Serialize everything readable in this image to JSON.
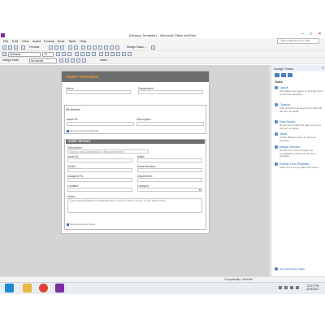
{
  "window": {
    "title": "(Design) Template1 - Microsoft Office InfoPath",
    "min": "–",
    "max": "□",
    "close": "✕"
  },
  "menu": {
    "items": [
      "File",
      "Edit",
      "View",
      "Insert",
      "Format",
      "Tools",
      "Table",
      "Help"
    ],
    "help_placeholder": "Type a question for help"
  },
  "toolbar": {
    "preview_label": "Preview",
    "design_tasks_label": "Design Tasks...",
    "font_name": "Verdana",
    "font_size": "10",
    "design_table_label": "Design Table",
    "border_label": "No border",
    "insert_label": "Insert"
  },
  "form": {
    "title": "ASSET TRACKING",
    "name_label": "Name:",
    "department_label": "Department:",
    "all_assets_title": "All Assets",
    "asset_id_label": "Asset ID:",
    "description_label": "Description:",
    "remove_asset_1": "Removing Asset (Variable)",
    "asset_details_title": "ASSET DETAILS",
    "details_description_label": "Description:",
    "details_description_hint": "[Type a short description of this asset here]",
    "details_asset_id_label": "Asset ID:",
    "make_label": "Make:",
    "model_label": "Model:",
    "serial_label": "Serial Number:",
    "assigned_label": "Assigned To:",
    "details_department_label": "Department:",
    "location_label": "Location:",
    "category_label": "Category:",
    "notes_label": "Notes:",
    "notes_hint": "[Type any additional comments about and/or insert a photo of the asset here]",
    "remove_asset_2": "Removing Asset (View)"
  },
  "taskpane": {
    "title": "Design Tasks",
    "close": "✕",
    "tasks_heading": "Tasks",
    "links": [
      {
        "label": "Layout",
        "desc": "Use tables and regions to arrange items on the form template."
      },
      {
        "label": "Controls",
        "desc": "Add controls to let users enter data into the form template."
      },
      {
        "label": "Data Source",
        "desc": "Review and modify the data source for the form template."
      },
      {
        "label": "Views",
        "desc": "Create different views for the form template."
      },
      {
        "label": "Design Checker",
        "desc": "Review and correct design and compatibility problems in the form template."
      },
      {
        "label": "Publish Form Template...",
        "desc": "Share this form template with others."
      }
    ],
    "help_label": "Help with Design Tasks"
  },
  "status": {
    "compatibility": "Compatibility: InfoPath"
  },
  "taskbar": {
    "time": "12:07 PM",
    "date": "4/25/2017"
  },
  "colors": {
    "banner": "#6e6e6e",
    "banner_title": "#f5a623",
    "canvas": "#d4d4d4"
  }
}
